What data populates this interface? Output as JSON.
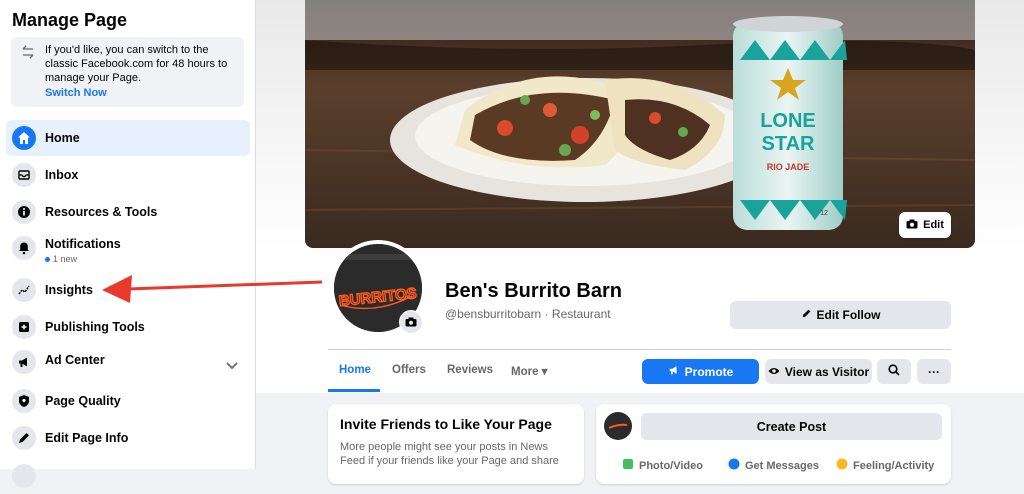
{
  "sidebar": {
    "title": "Manage Page",
    "notice": {
      "text": "If you'd like, you can switch to the classic Facebook.com for 48 hours to manage your Page.",
      "link": "Switch Now"
    },
    "items": [
      {
        "label": "Home"
      },
      {
        "label": "Inbox"
      },
      {
        "label": "Resources & Tools"
      },
      {
        "label": "Notifications",
        "sub": "1 new"
      },
      {
        "label": "Insights"
      },
      {
        "label": "Publishing Tools"
      },
      {
        "label": "Ad Center"
      },
      {
        "label": "Page Quality"
      },
      {
        "label": "Edit Page Info"
      }
    ]
  },
  "cover": {
    "edit_label": "Edit",
    "can_text": {
      "line1": "LONE",
      "line2": "STAR",
      "line3": "RIO JADE",
      "small": "12"
    }
  },
  "profile": {
    "sign_text": "BURRITOS",
    "name": "Ben's Burrito Barn",
    "handle": "@bensburritobarn · Restaurant"
  },
  "actions": {
    "edit_follow": "Edit Follow",
    "promote": "Promote",
    "view_as_visitor": "View as Visitor",
    "more_dots": "···"
  },
  "tabs": [
    {
      "label": "Home"
    },
    {
      "label": "Offers"
    },
    {
      "label": "Reviews"
    },
    {
      "label": "More ▾"
    }
  ],
  "invite_card": {
    "title": "Invite Friends to Like Your Page",
    "text": "More people might see your posts in News Feed if your friends like your Page and share"
  },
  "post_card": {
    "create_post": "Create Post",
    "photo_video": "Photo/Video",
    "get_messages": "Get Messages",
    "feeling": "Feeling/Activity"
  },
  "colors": {
    "accent": "#1877f2",
    "arrow": "#e8392c"
  }
}
